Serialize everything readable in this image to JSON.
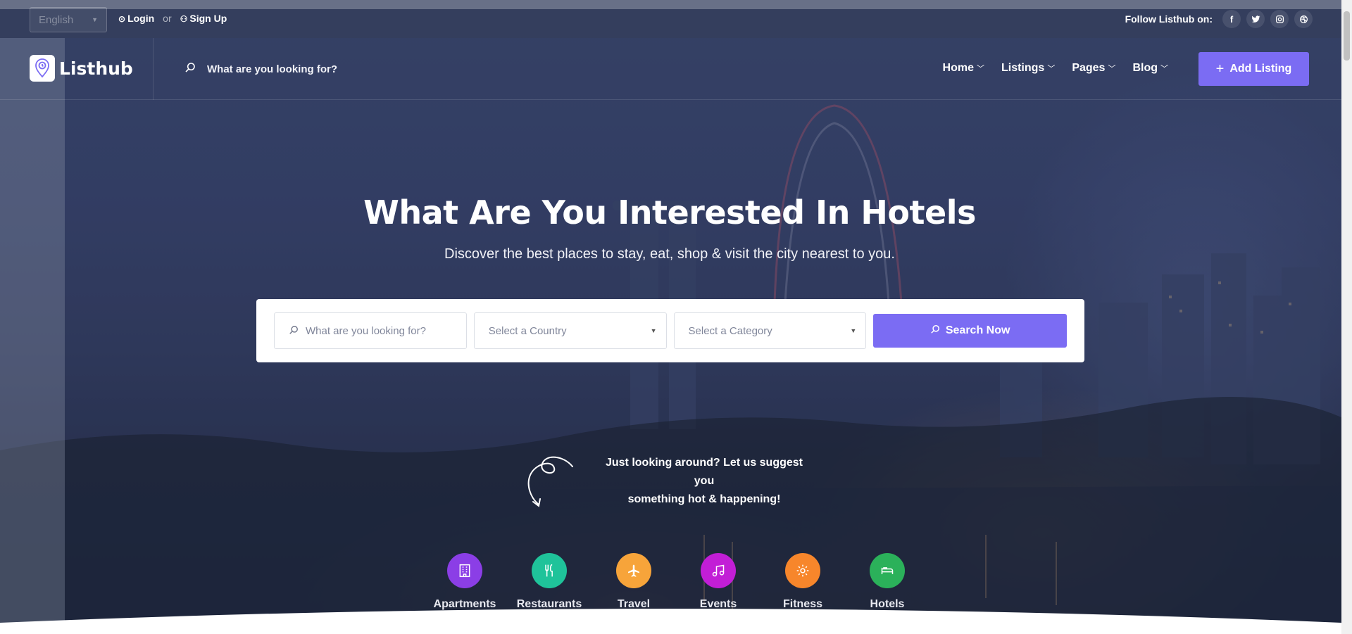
{
  "topbar": {
    "language": "English",
    "login": "Login",
    "or": "or",
    "signup": "Sign Up",
    "follow_label": "Follow Listhub on:",
    "social": [
      {
        "icon": "facebook-icon",
        "glyph": "f"
      },
      {
        "icon": "twitter-icon",
        "glyph": "t"
      },
      {
        "icon": "instagram-icon",
        "glyph": "◎"
      },
      {
        "icon": "dribbble-icon",
        "glyph": "⊛"
      }
    ]
  },
  "header": {
    "brand": "Listhub",
    "search_placeholder": "What are you looking for?",
    "nav": [
      "Home",
      "Listings",
      "Pages",
      "Blog"
    ],
    "add_listing": "Add Listing"
  },
  "hero": {
    "title": "What Are You Interested In Hotels",
    "subtitle": "Discover the best places to stay, eat, shop & visit the city nearest to you.",
    "search_placeholder": "What are you looking for?",
    "country_select": "Select a Country",
    "category_select": "Select a Category",
    "search_button": "Search Now",
    "suggest_line1": "Just looking around? Let us suggest you",
    "suggest_line2": "something hot & happening!"
  },
  "categories": [
    {
      "label": "Apartments",
      "color": "#8b3ee6",
      "icon": "building-icon"
    },
    {
      "label": "Restaurants",
      "color": "#1fc39a",
      "icon": "cutlery-icon"
    },
    {
      "label": "Travel",
      "color": "#f7a43a",
      "icon": "plane-icon"
    },
    {
      "label": "Events",
      "color": "#c21ed6",
      "icon": "music-icon"
    },
    {
      "label": "Fitness",
      "color": "#f7862b",
      "icon": "gear-icon"
    },
    {
      "label": "Hotels",
      "color": "#2bb15a",
      "icon": "bed-icon"
    }
  ],
  "colors": {
    "accent": "#7b6cf3"
  }
}
